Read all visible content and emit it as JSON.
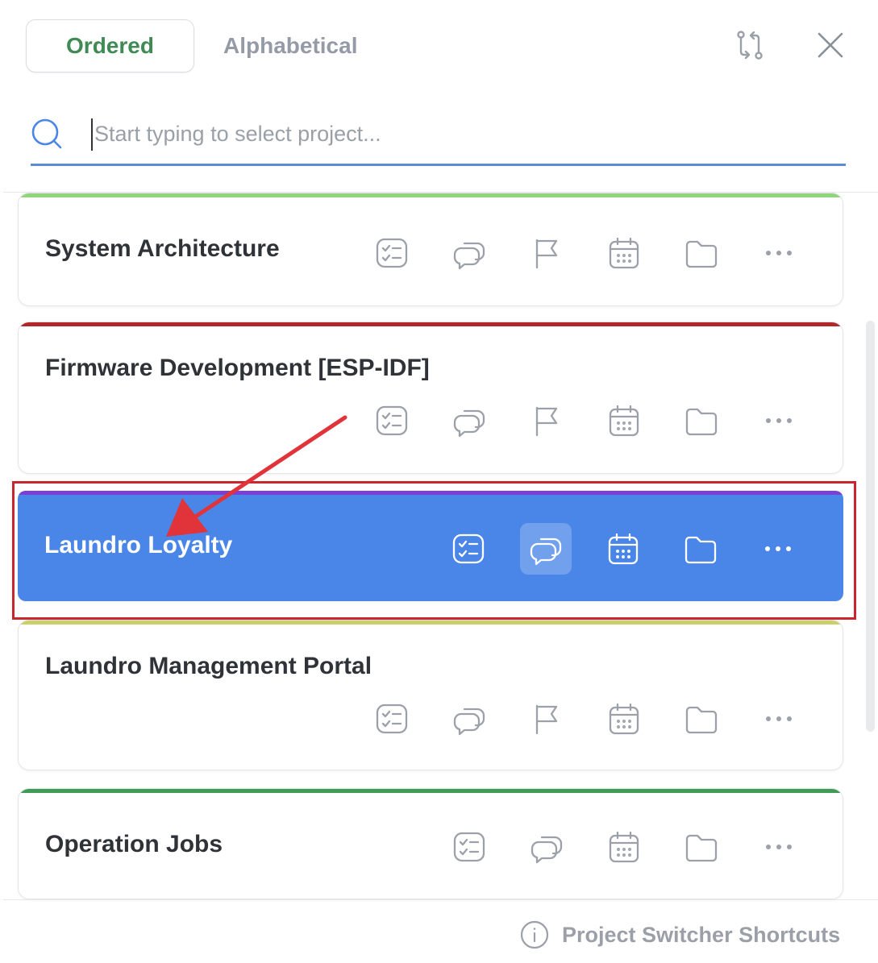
{
  "tabs": {
    "ordered": "Ordered",
    "alphabetical": "Alphabetical"
  },
  "search": {
    "placeholder": "Start typing to select project..."
  },
  "projects": [
    {
      "name": "System Architecture",
      "color": "#8fd67a",
      "actions": [
        "checklist-icon",
        "comments-icon",
        "flag-icon",
        "calendar-icon",
        "folder-icon",
        "more-icon"
      ]
    },
    {
      "name": "Firmware Development [ESP-IDF]",
      "color": "#b3262b",
      "actions": [
        "checklist-icon",
        "comments-icon",
        "flag-icon",
        "calendar-icon",
        "folder-icon",
        "more-icon"
      ]
    },
    {
      "name": "Laundro Loyalty",
      "color": "#7a3fd6",
      "selected": true,
      "actions": [
        "checklist-icon",
        "comments-icon",
        "calendar-icon",
        "folder-icon",
        "more-icon"
      ]
    },
    {
      "name": "Laundro Management Portal",
      "color": "#c9cf6a",
      "actions": [
        "checklist-icon",
        "comments-icon",
        "flag-icon",
        "calendar-icon",
        "folder-icon",
        "more-icon"
      ]
    },
    {
      "name": "Operation Jobs",
      "color": "#3f9b55",
      "actions": [
        "checklist-icon",
        "comments-icon",
        "calendar-icon",
        "folder-icon",
        "more-icon"
      ]
    }
  ],
  "footer": {
    "shortcuts_label": "Project Switcher Shortcuts"
  },
  "colors": {
    "accent": "#4a86e8",
    "ordered_text": "#3f8a55",
    "annotation": "#c8272d"
  }
}
